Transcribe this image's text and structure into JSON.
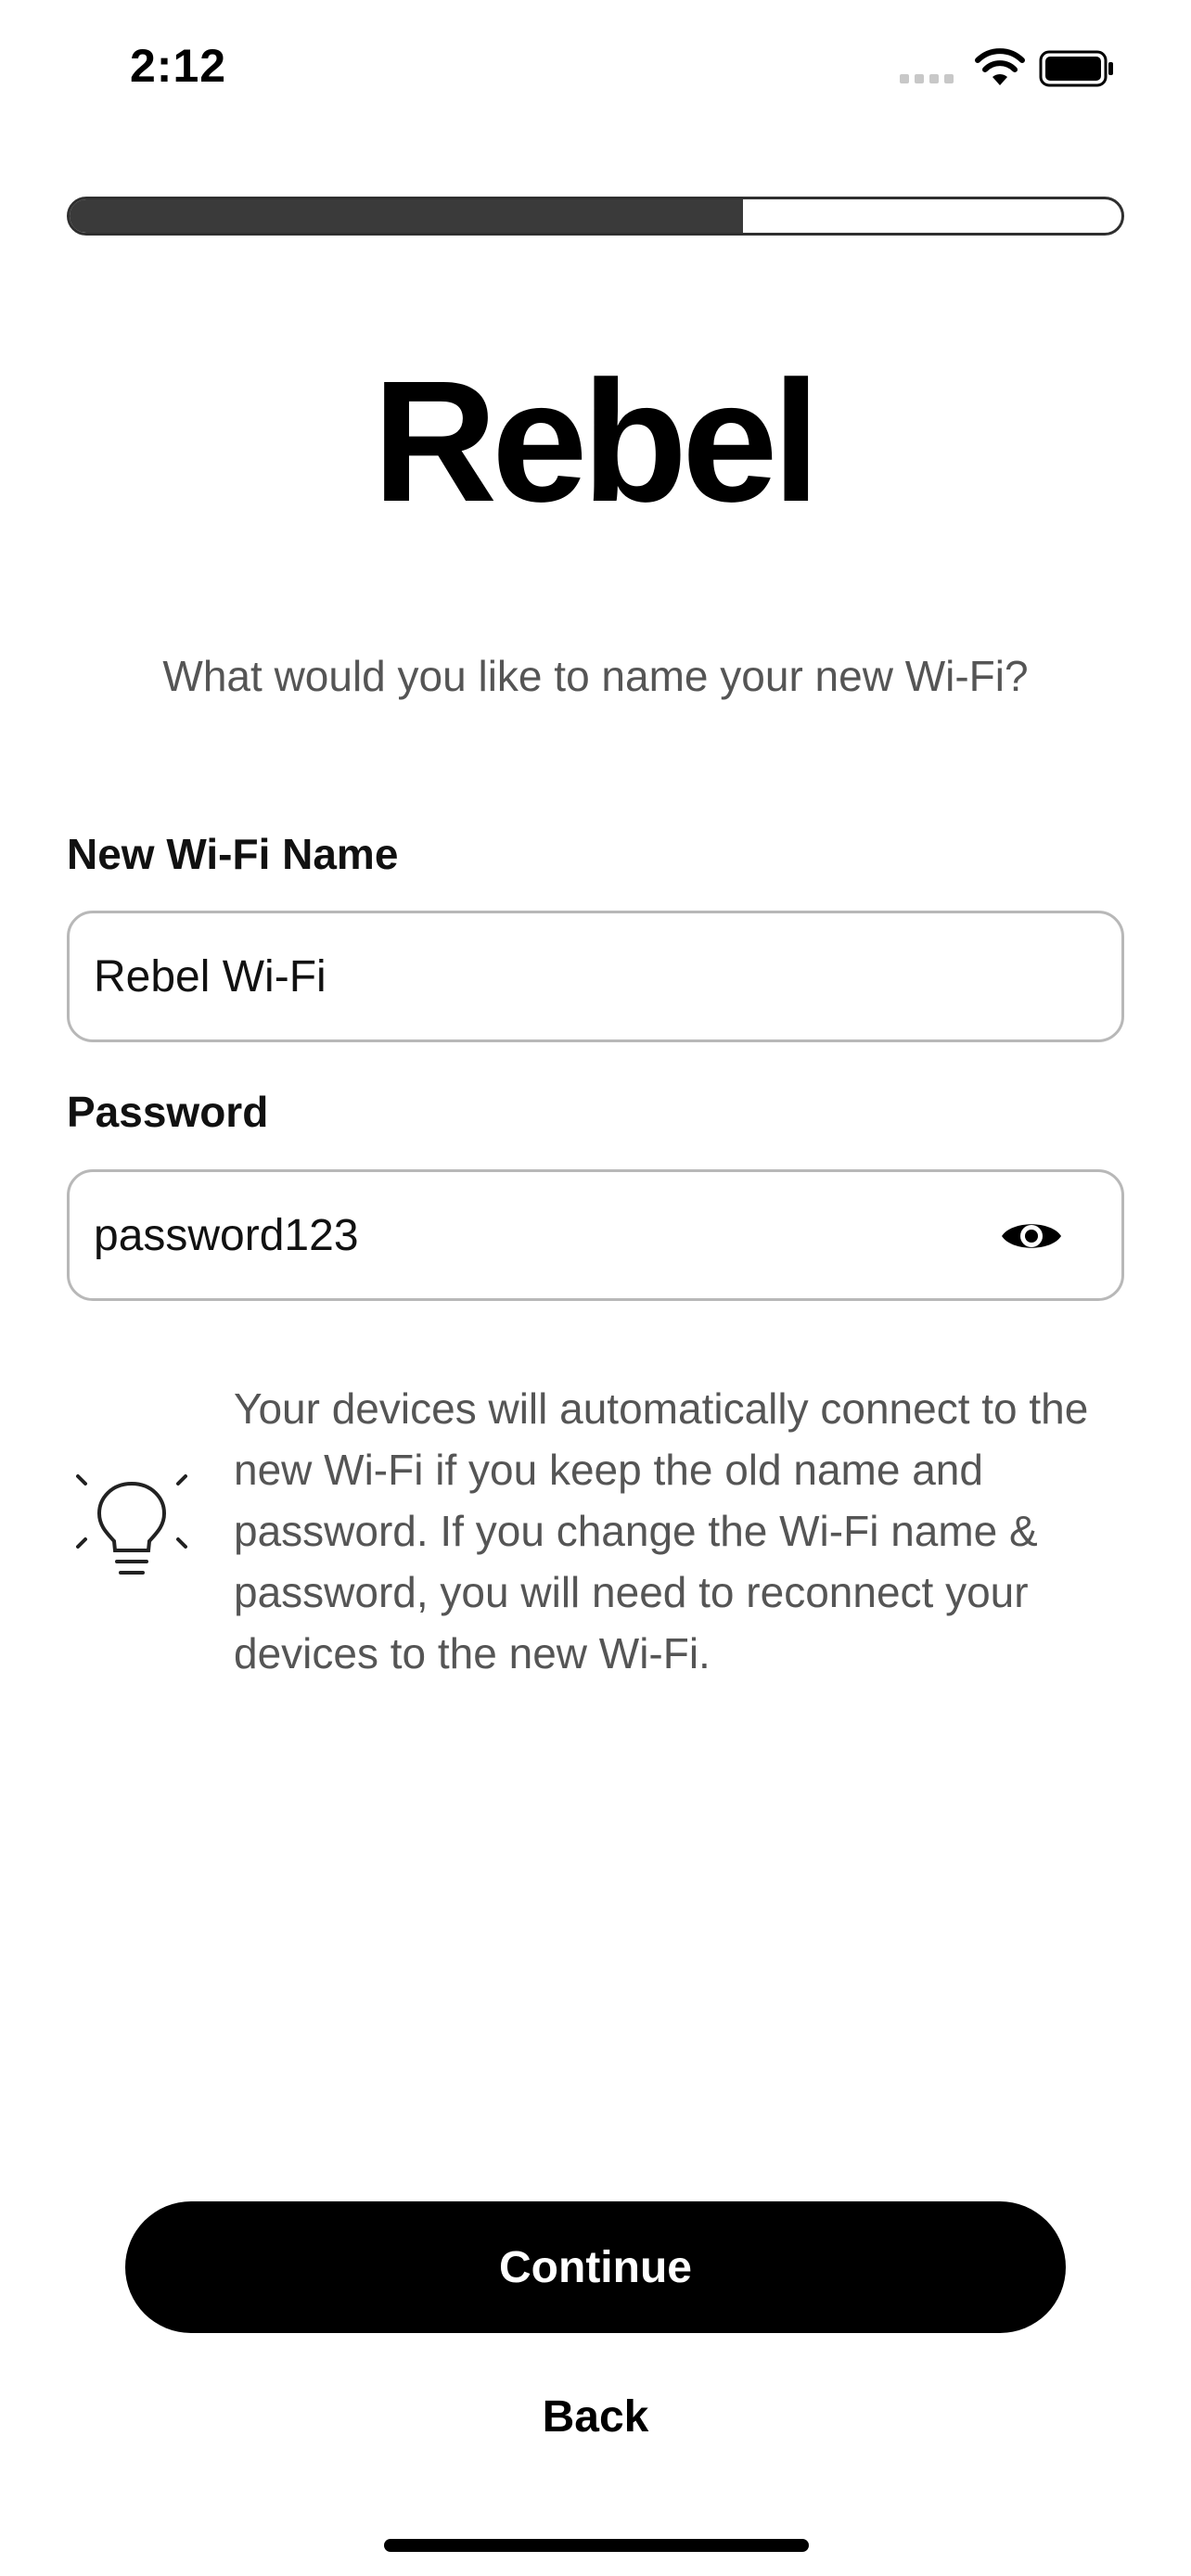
{
  "status_bar": {
    "time": "2:12"
  },
  "progress": {
    "fraction": 0.64
  },
  "logo": {
    "text": "Rebel"
  },
  "header": {
    "subtitle": "What would you like to name your new Wi-Fi?"
  },
  "form": {
    "name_label": "New Wi-Fi Name",
    "name_value": "Rebel Wi-Fi",
    "password_label": "Password",
    "password_value": "password123"
  },
  "tip": {
    "text": "Your devices will automatically connect to the new Wi-Fi if you keep the old name and password. If you change the Wi-Fi name & password, you will need to reconnect your devices to the new Wi-Fi."
  },
  "actions": {
    "continue_label": "Continue",
    "back_label": "Back"
  },
  "icons": {
    "wifi": "wifi-icon",
    "battery": "battery-icon",
    "signal": "signal-icon",
    "eye": "eye-icon",
    "bulb": "lightbulb-icon"
  },
  "colors": {
    "progress_fill": "#3a3a3a",
    "button_bg": "#000000",
    "muted_text": "#555555"
  }
}
